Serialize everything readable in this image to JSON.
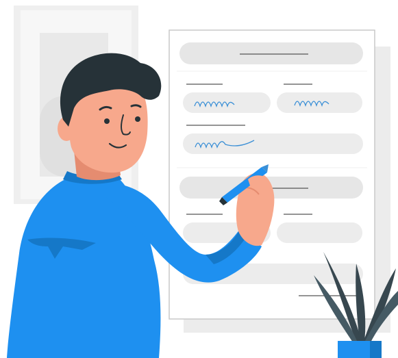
{
  "palette": {
    "shirt": "#1e90f0",
    "shirt_shadow": "#1578c8",
    "skin": "#f7a88c",
    "skin_shadow": "#e58c70",
    "hair": "#263238",
    "paper_border": "#c8c8c8",
    "field_gray": "#e6e6e6",
    "ink_blue": "#3a8fd6",
    "plant_dark": "#37474f",
    "pot_blue": "#1e90f0"
  },
  "icons": [
    "writing-man-illustration",
    "form-sheet-icon",
    "pen-icon",
    "plant-icon"
  ]
}
